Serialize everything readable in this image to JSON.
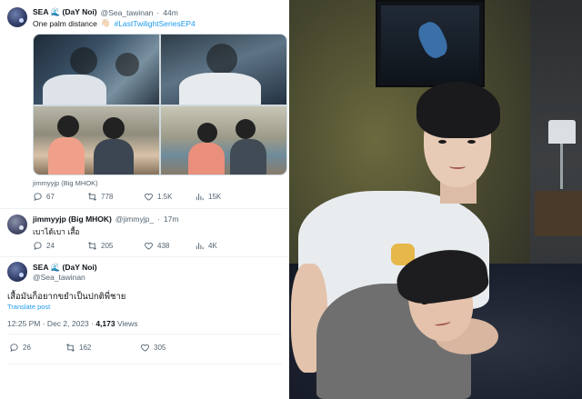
{
  "tweet1": {
    "display_name": "SEA",
    "wave_emoji": "🌊",
    "display_suffix": "(DaY Noi)",
    "handle": "@Sea_tawinan",
    "age": "44m",
    "text_plain": "One palm distance",
    "text_emoji": "👋🏻",
    "hashtag": "#LastTwilightSeriesEP4",
    "media_caption": "jimmyyjp (Big MHOK)",
    "stats": {
      "replies": "67",
      "reposts": "778",
      "likes": "1.5K",
      "views": "15K"
    }
  },
  "tweet2": {
    "display_name": "jimmyyjp (Big MHOK)",
    "handle": "@jimmyjp_",
    "age": "17m",
    "text": "เบาได้เบา เสื้อ",
    "stats": {
      "replies": "24",
      "reposts": "205",
      "likes": "438",
      "views": "4K"
    }
  },
  "tweet3": {
    "display_name": "SEA",
    "wave_emoji": "🌊",
    "display_suffix": "(DaY Noi)",
    "handle": "@Sea_tawinan",
    "text": "เสื้อมันก็อยากขยำเป็นปกติพี่ชาย",
    "translate": "Translate post",
    "timestamp": "12:25 PM · Dec 2, 2023 · ",
    "views_count": "4,173",
    "views_label": " Views",
    "stats": {
      "replies": "26",
      "reposts": "162",
      "likes": "305"
    }
  },
  "icons": {
    "reply": "reply-icon",
    "repost": "repost-icon",
    "like": "heart-icon",
    "views": "views-icon"
  },
  "colors": {
    "accent": "#1d9bf0",
    "text": "#0f1419",
    "muted": "#536471"
  }
}
